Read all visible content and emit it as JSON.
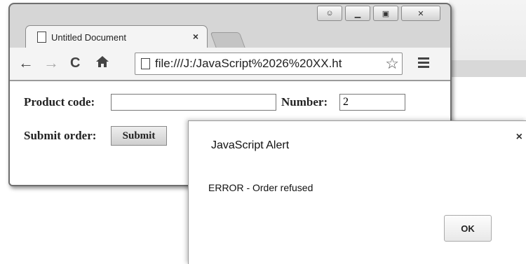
{
  "browser": {
    "tab": {
      "title": "Untitled Document",
      "close": "×"
    },
    "window_controls": {
      "minimize": "▁",
      "maximize": "▣",
      "close": "✕"
    },
    "toolbar": {
      "back": "←",
      "forward": "→",
      "reload": "C",
      "home": "🏠",
      "url": "file:///J:/JavaScript%2026%20XX.ht",
      "star": "☆"
    }
  },
  "form": {
    "product_code_label": "Product code:",
    "product_code_value": "",
    "number_label": "Number:",
    "number_value": "2",
    "submit_order_label": "Submit order:",
    "submit_button": "Submit"
  },
  "alert": {
    "title": "JavaScript Alert",
    "message": "ERROR - Order refused",
    "close": "×",
    "ok_button": "OK"
  }
}
